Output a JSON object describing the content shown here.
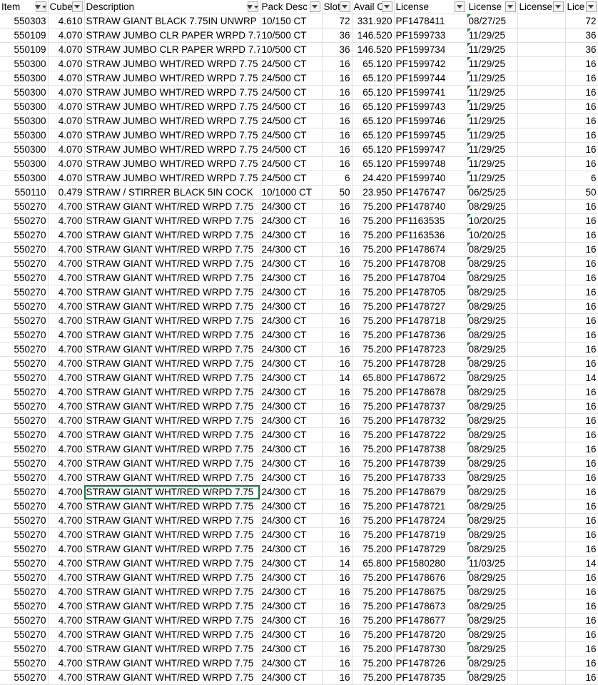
{
  "headers": [
    {
      "label": "Item",
      "filtered": true
    },
    {
      "label": "Cube",
      "filtered": false
    },
    {
      "label": "Description",
      "filtered": true
    },
    {
      "label": "Pack Desc",
      "filtered": false
    },
    {
      "label": "Slot",
      "filtered": false
    },
    {
      "label": "Avail C",
      "filtered": false
    },
    {
      "label": "License",
      "filtered": false
    },
    {
      "label": "License",
      "filtered": false
    },
    {
      "label": "License",
      "filtered": false
    },
    {
      "label": "Lice",
      "filtered": false
    }
  ],
  "rows": [
    [
      "550303",
      "4.610",
      "STRAW GIANT BLACK 7.75IN UNWRP",
      "10/150 CT",
      "72",
      "331.920",
      "PF1478411",
      "08/27/25",
      "",
      "72"
    ],
    [
      "550109",
      "4.070",
      "STRAW JUMBO CLR PAPER WRPD 7.7",
      "10/500 CT",
      "36",
      "146.520",
      "PF1599733",
      "11/29/25",
      "",
      "36"
    ],
    [
      "550109",
      "4.070",
      "STRAW JUMBO CLR PAPER WRPD 7.7",
      "10/500 CT",
      "36",
      "146.520",
      "PF1599734",
      "11/29/25",
      "",
      "36"
    ],
    [
      "550300",
      "4.070",
      "STRAW JUMBO WHT/RED WRPD 7.75",
      "24/500 CT",
      "16",
      "65.120",
      "PF1599742",
      "11/29/25",
      "",
      "16"
    ],
    [
      "550300",
      "4.070",
      "STRAW JUMBO WHT/RED WRPD 7.75",
      "24/500 CT",
      "16",
      "65.120",
      "PF1599744",
      "11/29/25",
      "",
      "16"
    ],
    [
      "550300",
      "4.070",
      "STRAW JUMBO WHT/RED WRPD 7.75",
      "24/500 CT",
      "16",
      "65.120",
      "PF1599741",
      "11/29/25",
      "",
      "16"
    ],
    [
      "550300",
      "4.070",
      "STRAW JUMBO WHT/RED WRPD 7.75",
      "24/500 CT",
      "16",
      "65.120",
      "PF1599743",
      "11/29/25",
      "",
      "16"
    ],
    [
      "550300",
      "4.070",
      "STRAW JUMBO WHT/RED WRPD 7.75",
      "24/500 CT",
      "16",
      "65.120",
      "PF1599746",
      "11/29/25",
      "",
      "16"
    ],
    [
      "550300",
      "4.070",
      "STRAW JUMBO WHT/RED WRPD 7.75",
      "24/500 CT",
      "16",
      "65.120",
      "PF1599745",
      "11/29/25",
      "",
      "16"
    ],
    [
      "550300",
      "4.070",
      "STRAW JUMBO WHT/RED WRPD 7.75",
      "24/500 CT",
      "16",
      "65.120",
      "PF1599747",
      "11/29/25",
      "",
      "16"
    ],
    [
      "550300",
      "4.070",
      "STRAW JUMBO WHT/RED WRPD 7.75",
      "24/500 CT",
      "16",
      "65.120",
      "PF1599748",
      "11/29/25",
      "",
      "16"
    ],
    [
      "550300",
      "4.070",
      "STRAW JUMBO WHT/RED WRPD 7.75",
      "24/500 CT",
      "6",
      "24.420",
      "PF1599740",
      "11/29/25",
      "",
      "6"
    ],
    [
      "550110",
      "0.479",
      "STRAW / STIRRER BLACK 5IN COCK",
      "10/1000 CT",
      "50",
      "23.950",
      "PF1476747",
      "06/25/25",
      "",
      "50"
    ],
    [
      "550270",
      "4.700",
      "STRAW GIANT WHT/RED WRPD 7.75",
      "24/300 CT",
      "16",
      "75.200",
      "PF1478740",
      "08/29/25",
      "",
      "16"
    ],
    [
      "550270",
      "4.700",
      "STRAW GIANT WHT/RED WRPD 7.75",
      "24/300 CT",
      "16",
      "75.200",
      "PF1163535",
      "10/20/25",
      "",
      "16"
    ],
    [
      "550270",
      "4.700",
      "STRAW GIANT WHT/RED WRPD 7.75",
      "24/300 CT",
      "16",
      "75.200",
      "PF1163536",
      "10/20/25",
      "",
      "16"
    ],
    [
      "550270",
      "4.700",
      "STRAW GIANT WHT/RED WRPD 7.75",
      "24/300 CT",
      "16",
      "75.200",
      "PF1478674",
      "08/29/25",
      "",
      "16"
    ],
    [
      "550270",
      "4.700",
      "STRAW GIANT WHT/RED WRPD 7.75",
      "24/300 CT",
      "16",
      "75.200",
      "PF1478708",
      "08/29/25",
      "",
      "16"
    ],
    [
      "550270",
      "4.700",
      "STRAW GIANT WHT/RED WRPD 7.75",
      "24/300 CT",
      "16",
      "75.200",
      "PF1478704",
      "08/29/25",
      "",
      "16"
    ],
    [
      "550270",
      "4.700",
      "STRAW GIANT WHT/RED WRPD 7.75",
      "24/300 CT",
      "16",
      "75.200",
      "PF1478705",
      "08/29/25",
      "",
      "16"
    ],
    [
      "550270",
      "4.700",
      "STRAW GIANT WHT/RED WRPD 7.75",
      "24/300 CT",
      "16",
      "75.200",
      "PF1478727",
      "08/29/25",
      "",
      "16"
    ],
    [
      "550270",
      "4.700",
      "STRAW GIANT WHT/RED WRPD 7.75",
      "24/300 CT",
      "16",
      "75.200",
      "PF1478718",
      "08/29/25",
      "",
      "16"
    ],
    [
      "550270",
      "4.700",
      "STRAW GIANT WHT/RED WRPD 7.75",
      "24/300 CT",
      "16",
      "75.200",
      "PF1478736",
      "08/29/25",
      "",
      "16"
    ],
    [
      "550270",
      "4.700",
      "STRAW GIANT WHT/RED WRPD 7.75",
      "24/300 CT",
      "16",
      "75.200",
      "PF1478723",
      "08/29/25",
      "",
      "16"
    ],
    [
      "550270",
      "4.700",
      "STRAW GIANT WHT/RED WRPD 7.75",
      "24/300 CT",
      "16",
      "75.200",
      "PF1478728",
      "08/29/25",
      "",
      "16"
    ],
    [
      "550270",
      "4.700",
      "STRAW GIANT WHT/RED WRPD 7.75",
      "24/300 CT",
      "14",
      "65.800",
      "PF1478672",
      "08/29/25",
      "",
      "14"
    ],
    [
      "550270",
      "4.700",
      "STRAW GIANT WHT/RED WRPD 7.75",
      "24/300 CT",
      "16",
      "75.200",
      "PF1478678",
      "08/29/25",
      "",
      "16"
    ],
    [
      "550270",
      "4.700",
      "STRAW GIANT WHT/RED WRPD 7.75",
      "24/300 CT",
      "16",
      "75.200",
      "PF1478737",
      "08/29/25",
      "",
      "16"
    ],
    [
      "550270",
      "4.700",
      "STRAW GIANT WHT/RED WRPD 7.75",
      "24/300 CT",
      "16",
      "75.200",
      "PF1478732",
      "08/29/25",
      "",
      "16"
    ],
    [
      "550270",
      "4.700",
      "STRAW GIANT WHT/RED WRPD 7.75",
      "24/300 CT",
      "16",
      "75.200",
      "PF1478722",
      "08/29/25",
      "",
      "16"
    ],
    [
      "550270",
      "4.700",
      "STRAW GIANT WHT/RED WRPD 7.75",
      "24/300 CT",
      "16",
      "75.200",
      "PF1478738",
      "08/29/25",
      "",
      "16"
    ],
    [
      "550270",
      "4.700",
      "STRAW GIANT WHT/RED WRPD 7.75",
      "24/300 CT",
      "16",
      "75.200",
      "PF1478739",
      "08/29/25",
      "",
      "16"
    ],
    [
      "550270",
      "4.700",
      "STRAW GIANT WHT/RED WRPD 7.75",
      "24/300 CT",
      "16",
      "75.200",
      "PF1478733",
      "08/29/25",
      "",
      "16"
    ],
    [
      "550270",
      "4.700",
      "STRAW GIANT WHT/RED WRPD 7.75",
      "24/300 CT",
      "16",
      "75.200",
      "PF1478679",
      "08/29/25",
      "",
      "16"
    ],
    [
      "550270",
      "4.700",
      "STRAW GIANT WHT/RED WRPD 7.75",
      "24/300 CT",
      "16",
      "75.200",
      "PF1478721",
      "08/29/25",
      "",
      "16"
    ],
    [
      "550270",
      "4.700",
      "STRAW GIANT WHT/RED WRPD 7.75",
      "24/300 CT",
      "16",
      "75.200",
      "PF1478724",
      "08/29/25",
      "",
      "16"
    ],
    [
      "550270",
      "4.700",
      "STRAW GIANT WHT/RED WRPD 7.75",
      "24/300 CT",
      "16",
      "75.200",
      "PF1478719",
      "08/29/25",
      "",
      "16"
    ],
    [
      "550270",
      "4.700",
      "STRAW GIANT WHT/RED WRPD 7.75",
      "24/300 CT",
      "16",
      "75.200",
      "PF1478729",
      "08/29/25",
      "",
      "16"
    ],
    [
      "550270",
      "4.700",
      "STRAW GIANT WHT/RED WRPD 7.75",
      "24/300 CT",
      "14",
      "65.800",
      "PF1580280",
      "11/03/25",
      "",
      "14"
    ],
    [
      "550270",
      "4.700",
      "STRAW GIANT WHT/RED WRPD 7.75",
      "24/300 CT",
      "16",
      "75.200",
      "PF1478676",
      "08/29/25",
      "",
      "16"
    ],
    [
      "550270",
      "4.700",
      "STRAW GIANT WHT/RED WRPD 7.75",
      "24/300 CT",
      "16",
      "75.200",
      "PF1478675",
      "08/29/25",
      "",
      "16"
    ],
    [
      "550270",
      "4.700",
      "STRAW GIANT WHT/RED WRPD 7.75",
      "24/300 CT",
      "16",
      "75.200",
      "PF1478673",
      "08/29/25",
      "",
      "16"
    ],
    [
      "550270",
      "4.700",
      "STRAW GIANT WHT/RED WRPD 7.75",
      "24/300 CT",
      "16",
      "75.200",
      "PF1478677",
      "08/29/25",
      "",
      "16"
    ],
    [
      "550270",
      "4.700",
      "STRAW GIANT WHT/RED WRPD 7.75",
      "24/300 CT",
      "16",
      "75.200",
      "PF1478720",
      "08/29/25",
      "",
      "16"
    ],
    [
      "550270",
      "4.700",
      "STRAW GIANT WHT/RED WRPD 7.75",
      "24/300 CT",
      "16",
      "75.200",
      "PF1478730",
      "08/29/25",
      "",
      "16"
    ],
    [
      "550270",
      "4.700",
      "STRAW GIANT WHT/RED WRPD 7.75",
      "24/300 CT",
      "16",
      "75.200",
      "PF1478726",
      "08/29/25",
      "",
      "16"
    ],
    [
      "550270",
      "4.700",
      "STRAW GIANT WHT/RED WRPD 7.75",
      "24/300 CT",
      "16",
      "75.200",
      "PF1478735",
      "08/29/25",
      "",
      "16"
    ]
  ],
  "selected_row": 33,
  "selected_col": 2,
  "colors": {
    "grid": "#e0e0e0",
    "selection": "#217346",
    "text_indicator": "#1f7a3a"
  }
}
